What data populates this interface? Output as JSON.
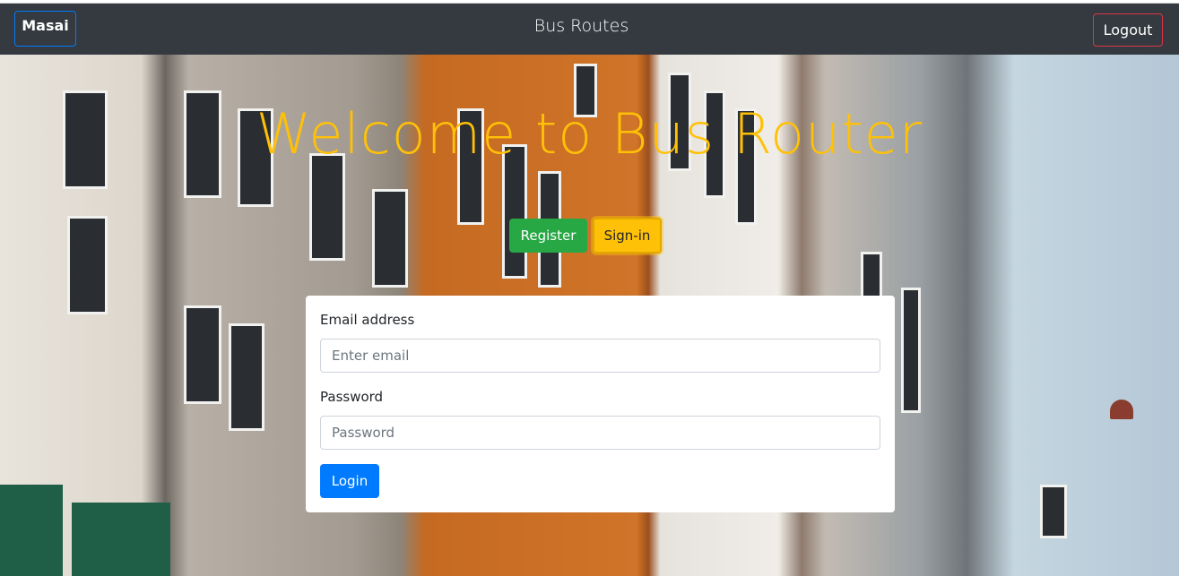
{
  "navbar": {
    "brand_label": "Masai",
    "title": "Bus Routes",
    "logout_label": "Logout"
  },
  "hero": {
    "title": "Welcome to Bus Router",
    "register_label": "Register",
    "signin_label": "Sign-in"
  },
  "login_form": {
    "email_label": "Email address",
    "email_placeholder": "Enter email",
    "password_label": "Password",
    "password_placeholder": "Password",
    "login_label": "Login"
  },
  "colors": {
    "navbar_bg": "#343a40",
    "title_yellow": "#ffc107",
    "register_green": "#28a745",
    "login_blue": "#007bff",
    "logout_red": "#dc3545"
  }
}
